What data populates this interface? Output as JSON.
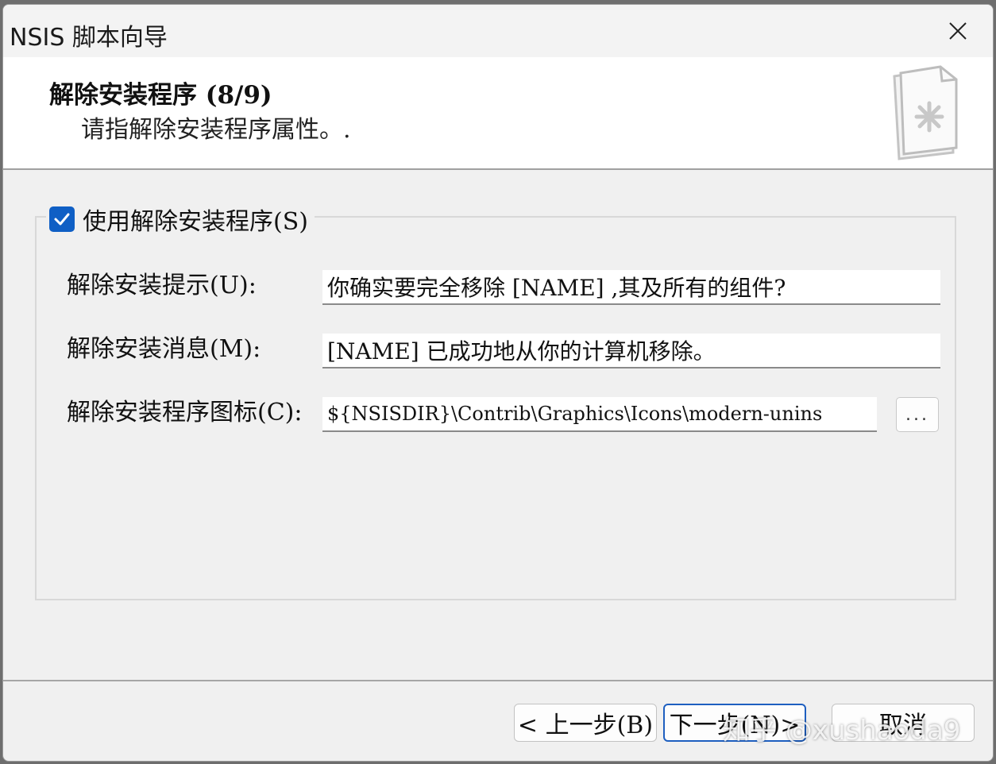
{
  "window": {
    "title": "NSIS 脚本向导"
  },
  "header": {
    "title": "解除安装程序 (8/9)",
    "subtitle": "请指解除安装程序属性。."
  },
  "uninstaller": {
    "use_label": "使用解除安装程序(S)",
    "use_checked": true,
    "prompt_label": "解除安装提示(U):",
    "prompt_value": "你确实要完全移除 [NAME] ,其及所有的组件?",
    "message_label": "解除安装消息(M):",
    "message_value": "[NAME] 已成功地从你的计算机移除。",
    "icon_label": "解除安装程序图标(C):",
    "icon_value": "${NSISDIR}\\Contrib\\Graphics\\Icons\\modern-unins",
    "browse_label": "..."
  },
  "footer": {
    "back_label": "< 上一步(B)",
    "next_label": "下一步(N)>",
    "cancel_label": "取消"
  },
  "watermark": {
    "text": "知乎 @xushaoda9"
  },
  "colors": {
    "accent": "#0f5fc5",
    "focus_border": "#1e5fc0"
  }
}
